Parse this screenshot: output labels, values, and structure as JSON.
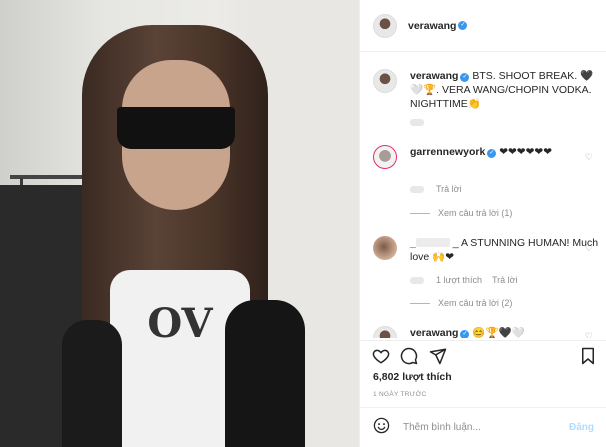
{
  "post": {
    "username": "verawang",
    "caption_text": "BTS. SHOOT BREAK. 🖤🤍🏆. VERA WANG/CHOPIN VODKA. NIGHTTIME👏",
    "photo_logo_text": "OV"
  },
  "comments": [
    {
      "username": "garrennewyork",
      "text": "❤❤❤❤❤❤",
      "reply_label": "Trả lời",
      "view_replies": "Xem câu trả lời (1)"
    },
    {
      "username_visible": "_",
      "text": "_ A STUNNING HUMAN! Much love 🙌❤",
      "likes_label": "1 lượt thích",
      "reply_label": "Trả lời",
      "view_replies": "Xem câu trả lời (2)"
    },
    {
      "username": "verawang",
      "text": "😊🏆🖤🤍"
    }
  ],
  "footer": {
    "likes": "6,802 lượt thích",
    "date": "1 NGÀY TRƯỚC",
    "comment_placeholder": "Thêm bình luận...",
    "post_button": "Đăng"
  },
  "icons": [
    "heart-icon",
    "comment-icon",
    "share-icon",
    "bookmark-icon",
    "emoji-icon",
    "verified-icon"
  ],
  "colors": {
    "verified": "#3897f0",
    "heart": "#ed4956",
    "post_disabled": "#b3dbff"
  }
}
